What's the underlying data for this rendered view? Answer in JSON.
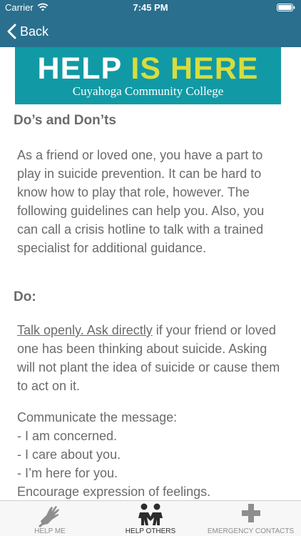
{
  "status_bar": {
    "carrier": "Carrier",
    "time": "7:45 PM"
  },
  "nav": {
    "back_label": "Back",
    "bar_color": "#2a6f8e"
  },
  "banner": {
    "title_part1": "HELP",
    "title_part2": "IS HERE",
    "subtitle": "Cuyahoga Community College",
    "background_color": "#119aa5",
    "accent_color": "#d6dd3f"
  },
  "content": {
    "heading_dos_donts": "Do’s and Don’ts",
    "intro": "As a friend or loved one, you have a part to play in suicide prevention. It can be hard to know how to play that role, however. The following guidelines can help you. Also, you can call a crisis hotline to talk with a trained specialist for additional guidance.",
    "heading_do": "Do:",
    "do_item1_link": "Talk openly. Ask directly",
    "do_item1_rest": " if your friend or loved one has been thinking about suicide. Asking will not plant the idea of suicide or cause them to act on it.",
    "message_intro": "Communicate the message:",
    "message_line1": "- I am concerned.",
    "message_line2": "- I care about you.",
    "message_line3": "- I’m here for you.",
    "message_line4": "Encourage expression of feelings."
  },
  "tabbar": {
    "tabs": [
      {
        "label": "HELP ME",
        "icon": "hand-icon",
        "active": false
      },
      {
        "label": "HELP OTHERS",
        "icon": "people-icon",
        "active": true
      },
      {
        "label": "EMERGENCY CONTACTS",
        "icon": "plus-cross-icon",
        "active": false
      }
    ]
  }
}
